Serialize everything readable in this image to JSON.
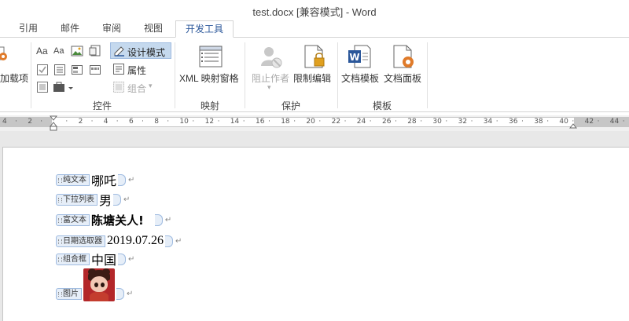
{
  "window": {
    "title": "test.docx [兼容模式] - Word"
  },
  "tabs": [
    {
      "label": "引用"
    },
    {
      "label": "邮件"
    },
    {
      "label": "审阅"
    },
    {
      "label": "视图"
    },
    {
      "label": "开发工具",
      "active": true
    }
  ],
  "ribbon": {
    "addins_partial_label": "加载项",
    "controls": {
      "group_label": "控件",
      "design_mode_label": "设计模式",
      "properties_label": "属性",
      "group_combo_label": "组合"
    },
    "mapping": {
      "group_label": "映射",
      "xml_pane_label": "XML 映射窗格"
    },
    "protect": {
      "group_label": "保护",
      "block_authors_label": "阻止作者",
      "restrict_editing_label": "限制编辑"
    },
    "templates": {
      "group_label": "模板",
      "doc_template_label": "文档模板",
      "doc_panel_label": "文档面板"
    }
  },
  "ruler": {
    "ticks": [
      "4",
      "2",
      "",
      "2",
      "4",
      "6",
      "8",
      "10",
      "12",
      "14",
      "16",
      "18",
      "20",
      "22",
      "24",
      "26",
      "28",
      "30",
      "32",
      "34",
      "36",
      "38",
      "40",
      "42",
      "44"
    ]
  },
  "document": {
    "controls": [
      {
        "tag": "纯文本",
        "content": "哪吒",
        "type": "text"
      },
      {
        "tag": "下拉列表",
        "content": "男",
        "type": "text"
      },
      {
        "tag": "富文本",
        "content": "陈塘关人!",
        "type": "rich"
      },
      {
        "tag": "日期选取器",
        "content": "2019.07.26",
        "type": "text"
      },
      {
        "tag": "组合框",
        "content": "中国",
        "type": "text"
      },
      {
        "tag": "图片",
        "content": "",
        "type": "picture"
      }
    ],
    "paragraph_mark": "↵"
  },
  "colors": {
    "accent": "#2b579a",
    "design_mode_bg": "#c5d9ee",
    "content_control_border": "#9fbbe0"
  }
}
